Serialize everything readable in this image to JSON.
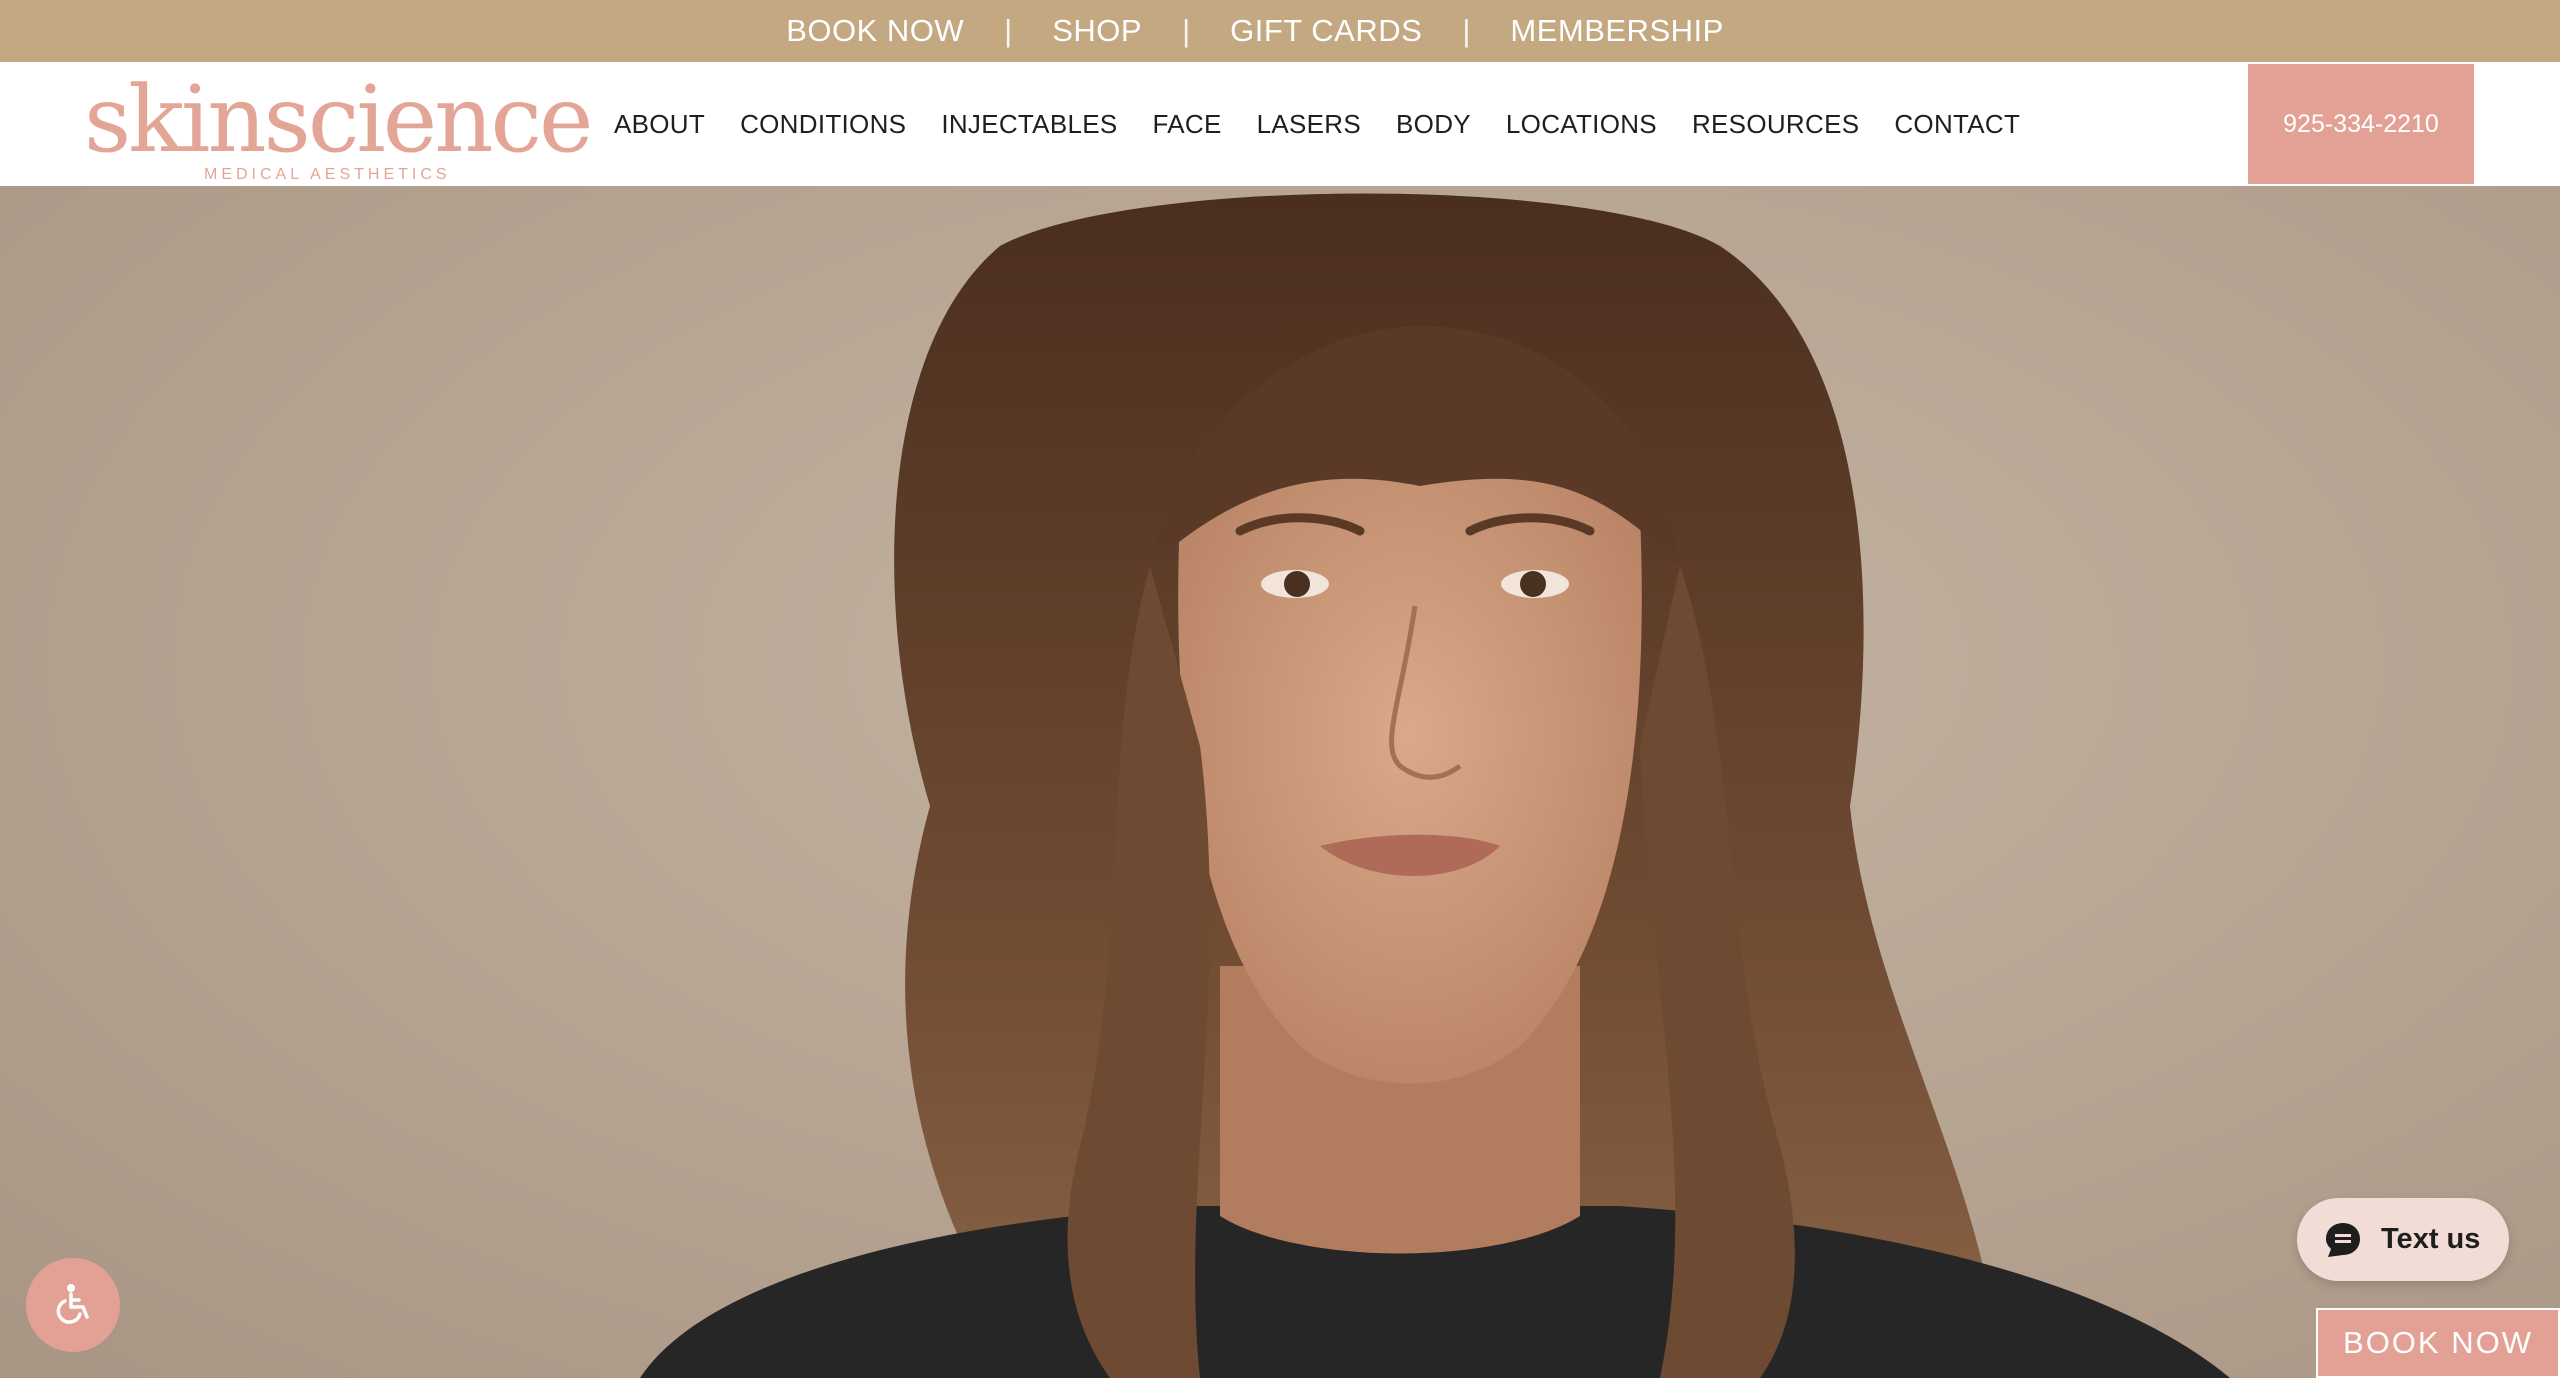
{
  "top_bar": {
    "links": [
      "BOOK NOW",
      "SHOP",
      "GIFT CARDS",
      "MEMBERSHIP"
    ],
    "separator": "|",
    "background_color": "#c4a882"
  },
  "header": {
    "logo": {
      "wordmark": "skinscience",
      "tagline": "MEDICAL AESTHETICS",
      "color": "#e3a596"
    },
    "nav": [
      "ABOUT",
      "CONDITIONS",
      "INJECTABLES",
      "FACE",
      "LASERS",
      "BODY",
      "LOCATIONS",
      "RESOURCES",
      "CONTACT"
    ],
    "phone": "925-334-2210",
    "accent_color": "#e3a195"
  },
  "hero": {
    "image": "portrait-photo-woman-with-bangs"
  },
  "widgets": {
    "accessibility_icon": "wheelchair-accessibility-icon",
    "text_us_label": "Text us",
    "text_us_icon": "chat-bubble-icon",
    "book_now_label": "BOOK NOW"
  }
}
